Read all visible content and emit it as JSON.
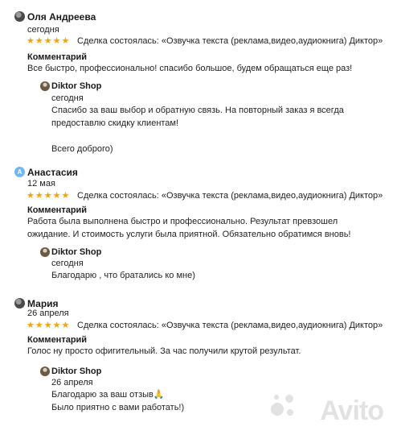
{
  "reviews": [
    {
      "author": "Оля Андреева",
      "date": "сегодня",
      "stars": "★★★★★",
      "deal": "Сделка состоялась: «Озвучка текста (реклама,видео,аудиокнига) Диктор»",
      "comment_label": "Комментарий",
      "comment": "Все быстро, профессионально! спасибо большое, будем обращаться еще раз!",
      "reply": {
        "author": "Diktor Shop",
        "date": "сегодня",
        "text": "Спасибо за ваш выбор и обратную связь. На повторный заказ я всегда предоставлю скидку клиентам!\n\nВсего доброго)"
      }
    },
    {
      "author": "Анастасия",
      "avatar_letter": "А",
      "date": "12 мая",
      "stars": "★★★★★",
      "deal": "Сделка состоялась: «Озвучка текста (реклама,видео,аудиокнига) Диктор»",
      "comment_label": "Комментарий",
      "comment": "Работа была выполнена быстро и профессионально. Результат превзошел ожидание. И стоимость услуги была приятной. Обязательно обратимся вновь!",
      "reply": {
        "author": "Diktor Shop",
        "date": "сегодня",
        "text": "Благодарю , что братались ко мне)"
      }
    },
    {
      "author": "Мария",
      "date": "26 апреля",
      "stars": "★★★★★",
      "deal": "Сделка состоялась: «Озвучка текста (реклама,видео,аудиокнига) Диктор»",
      "comment_label": "Комментарий",
      "comment": "Голос ну просто офигительный. За час получили крутой результат.",
      "reply": {
        "author": "Diktor Shop",
        "date": "26 апреля",
        "text": "Благодарю за ваш отзыв🙏\nБыло приятно с вами работать!)"
      }
    }
  ],
  "watermark": "Avito",
  "colors": {
    "star": "#f5a500",
    "avatar_letter_bg": "#6fb6f2"
  }
}
